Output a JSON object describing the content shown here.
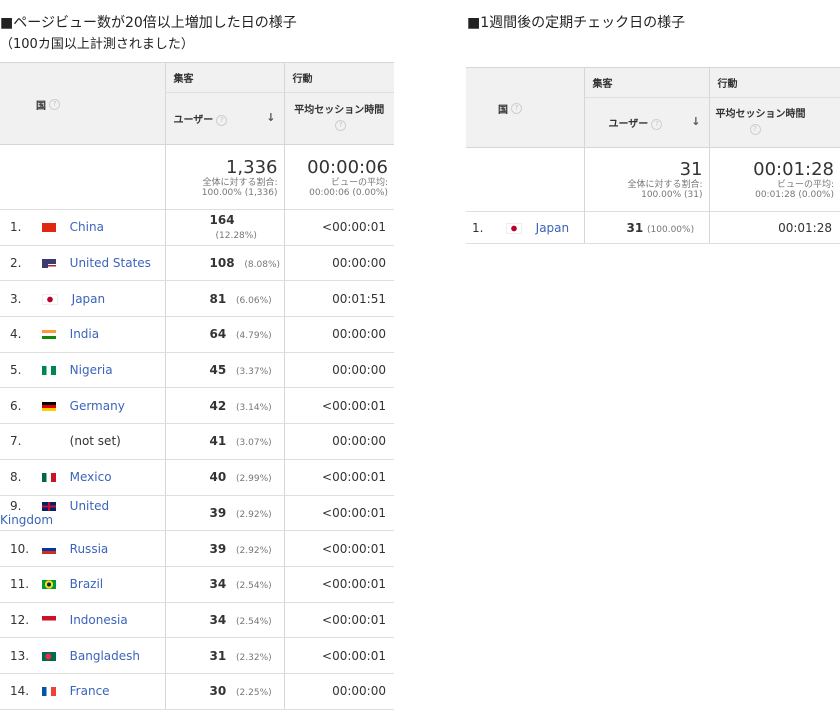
{
  "captions": {
    "left_title": "■ページビュー数が20倍以上増加した日の様子",
    "left_sub": "（100カ国以上計測されました）",
    "right_title": "■1週間後の定期チェック日の様子"
  },
  "left": {
    "header": {
      "country": "国",
      "group_acq": "集客",
      "group_beh": "行動",
      "users": "ユーザー",
      "avg_session": "平均セッション時間"
    },
    "totals": {
      "users": "1,336",
      "users_note1": "全体に対する割合:",
      "users_note2": "100.00% (1,336)",
      "avg": "00:00:06",
      "avg_note1": "ビューの平均:",
      "avg_note2": "00:00:06 (0.00%)"
    },
    "rows": [
      {
        "idx": "1.",
        "country": "China",
        "users": "164",
        "pct": "(12.28%)",
        "avg": "<00:00:01",
        "flag": "cn"
      },
      {
        "idx": "2.",
        "country": "United States",
        "users": "108",
        "pct": "(8.08%)",
        "avg": "00:00:00",
        "flag": "us"
      },
      {
        "idx": "3.",
        "country": "Japan",
        "users": "81",
        "pct": "(6.06%)",
        "avg": "00:01:51",
        "flag": "jp"
      },
      {
        "idx": "4.",
        "country": "India",
        "users": "64",
        "pct": "(4.79%)",
        "avg": "00:00:00",
        "flag": "in"
      },
      {
        "idx": "5.",
        "country": "Nigeria",
        "users": "45",
        "pct": "(3.37%)",
        "avg": "00:00:00",
        "flag": "ng"
      },
      {
        "idx": "6.",
        "country": "Germany",
        "users": "42",
        "pct": "(3.14%)",
        "avg": "<00:00:01",
        "flag": "de"
      },
      {
        "idx": "7.",
        "country": "(not set)",
        "users": "41",
        "pct": "(3.07%)",
        "avg": "00:00:00",
        "flag": "none"
      },
      {
        "idx": "8.",
        "country": "Mexico",
        "users": "40",
        "pct": "(2.99%)",
        "avg": "<00:00:01",
        "flag": "mx"
      },
      {
        "idx": "9.",
        "country": "United Kingdom",
        "users": "39",
        "pct": "(2.92%)",
        "avg": "<00:00:01",
        "flag": "gb"
      },
      {
        "idx": "10.",
        "country": "Russia",
        "users": "39",
        "pct": "(2.92%)",
        "avg": "<00:00:01",
        "flag": "ru"
      },
      {
        "idx": "11.",
        "country": "Brazil",
        "users": "34",
        "pct": "(2.54%)",
        "avg": "<00:00:01",
        "flag": "br"
      },
      {
        "idx": "12.",
        "country": "Indonesia",
        "users": "34",
        "pct": "(2.54%)",
        "avg": "<00:00:01",
        "flag": "id"
      },
      {
        "idx": "13.",
        "country": "Bangladesh",
        "users": "31",
        "pct": "(2.32%)",
        "avg": "<00:00:01",
        "flag": "bd"
      },
      {
        "idx": "14.",
        "country": "France",
        "users": "30",
        "pct": "(2.25%)",
        "avg": "00:00:00",
        "flag": "fr"
      }
    ]
  },
  "right": {
    "header": {
      "country": "国",
      "group_acq": "集客",
      "group_beh": "行動",
      "users": "ユーザー",
      "avg_session": "平均セッション時間"
    },
    "totals": {
      "users": "31",
      "users_note1": "全体に対する割合:",
      "users_note2": "100.00% (31)",
      "avg": "00:01:28",
      "avg_note1": "ビューの平均:",
      "avg_note2": "00:01:28 (0.00%)"
    },
    "rows": [
      {
        "idx": "1.",
        "country": "Japan",
        "users": "31",
        "pct": "(100.00%)",
        "avg": "00:01:28",
        "flag": "jp"
      }
    ]
  },
  "icons": {
    "help": "question-circle-icon",
    "sort": "sort-down-arrow-icon",
    "help_glyph": "?",
    "sort_glyph": "↓"
  }
}
